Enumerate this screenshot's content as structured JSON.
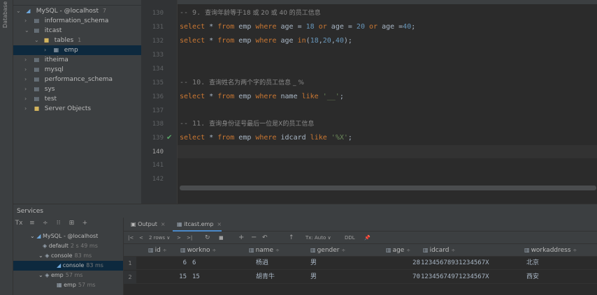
{
  "left_strip": {
    "label": "Database"
  },
  "tree": {
    "items": [
      {
        "label": "MySQL - @localhost",
        "count": "7",
        "icon": "mysql-datasource-icon",
        "chevron": "⌄",
        "depth": 0
      },
      {
        "label": "information_schema",
        "count": "",
        "icon": "schema-icon",
        "chevron": "›",
        "depth": 1
      },
      {
        "label": "itcast",
        "count": "",
        "icon": "schema-icon",
        "chevron": "⌄",
        "depth": 1
      },
      {
        "label": "tables",
        "count": "1",
        "icon": "folder-icon",
        "chevron": "⌄",
        "depth": 2
      },
      {
        "label": "emp",
        "count": "",
        "icon": "table-icon",
        "chevron": "›",
        "depth": 3
      },
      {
        "label": "itheima",
        "count": "",
        "icon": "schema-icon",
        "chevron": "›",
        "depth": 1
      },
      {
        "label": "mysql",
        "count": "",
        "icon": "schema-icon",
        "chevron": "›",
        "depth": 1
      },
      {
        "label": "performance_schema",
        "count": "",
        "icon": "schema-icon",
        "chevron": "›",
        "depth": 1
      },
      {
        "label": "sys",
        "count": "",
        "icon": "schema-icon",
        "chevron": "›",
        "depth": 1
      },
      {
        "label": "test",
        "count": "",
        "icon": "schema-icon",
        "chevron": "›",
        "depth": 1
      },
      {
        "label": "Server Objects",
        "count": "",
        "icon": "folder-icon",
        "chevron": "›",
        "depth": 1
      }
    ]
  },
  "editor": {
    "line_numbers": [
      "130",
      "131",
      "132",
      "133",
      "134",
      "135",
      "136",
      "137",
      "138",
      "139",
      "140",
      "141",
      "142"
    ],
    "current_line": "140",
    "lines": {
      "l130": {
        "comment": "-- 9. ",
        "comment_cn": "查询年龄等于18 或 20 或 40 的员工信息"
      },
      "l131": {
        "select": "select",
        "star": " * ",
        "from": "from",
        "tbl": " emp ",
        "where": "where",
        "c1": " age = ",
        "n1": "18",
        "or1": " or ",
        "c2": "age = ",
        "n2": "20",
        "or2": " or ",
        "c3": "age =",
        "n3": "40",
        "end": ";"
      },
      "l132": {
        "select": "select",
        "star": " * ",
        "from": "from",
        "tbl": " emp ",
        "where": "where",
        "col": " age ",
        "in": "in",
        "p1": "(",
        "n1": "18",
        "c1": ",",
        "n2": "20",
        "c2": ",",
        "n3": "40",
        "end": ");"
      },
      "l135": {
        "comment": "-- 10. ",
        "comment_cn": "查询姓名为两个字的员工信息 _ %"
      },
      "l136": {
        "select": "select",
        "star": " * ",
        "from": "from",
        "tbl": " emp ",
        "where": "where",
        "col": " name ",
        "like": "like",
        "sp": " ",
        "str": "'__'",
        "end": ";"
      },
      "l138": {
        "comment": "-- 11. ",
        "comment_cn": "查询身份证号最后一位是X的员工信息"
      },
      "l139": {
        "select": "select",
        "star": " * ",
        "from": "from",
        "tbl": " emp ",
        "where": "where",
        "col": " idcard ",
        "like": "like",
        "sp": " ",
        "str": "'%X'",
        "end": ";"
      }
    },
    "check_mark": "✔"
  },
  "services": {
    "title": "Services",
    "toolbar": [
      "Tx",
      "≡",
      "÷",
      "⁝⁝",
      "⊞",
      "+"
    ],
    "tree": [
      {
        "label": "MySQL - @localhost",
        "meta": ""
      },
      {
        "label": "default",
        "meta": "2 s 49 ms"
      },
      {
        "label": "console",
        "meta": "83 ms"
      },
      {
        "label": "console",
        "meta": "83 ms"
      },
      {
        "label": "emp",
        "meta": "57 ms"
      },
      {
        "label": "emp",
        "meta": "57 ms"
      }
    ]
  },
  "results": {
    "tabs": [
      {
        "label": "Output",
        "close": "×"
      },
      {
        "label": "itcast.emp",
        "close": "×"
      }
    ],
    "toolbar": {
      "first": "|<",
      "prev": "<",
      "rows": "2 rows ∨",
      "next": ">",
      "last": ">|",
      "reload": "↻",
      "stop": "■",
      "add": "+",
      "remove": "−",
      "revert": "↶",
      "submit": "↑",
      "tx": "Tx: Auto ∨",
      "ddl": "DDL",
      "pin": "📌"
    },
    "columns": [
      {
        "label": "id",
        "sort": "÷"
      },
      {
        "label": "workno",
        "sort": "÷"
      },
      {
        "label": "name",
        "sort": "÷"
      },
      {
        "label": "gender",
        "sort": "÷"
      },
      {
        "label": "age",
        "sort": "÷"
      },
      {
        "label": "idcard",
        "sort": "÷"
      },
      {
        "label": "workaddress",
        "sort": "÷"
      }
    ],
    "rows": [
      {
        "n": "1",
        "id": "6",
        "workno": "6",
        "name": "杨逍",
        "gender": "男",
        "age": "28",
        "idcard": "12345678931234567X",
        "workaddress": "北京"
      },
      {
        "n": "2",
        "id": "15",
        "workno": "15",
        "name": "胡青牛",
        "gender": "男",
        "age": "70",
        "idcard": "12345674971234567X",
        "workaddress": "西安"
      }
    ]
  }
}
